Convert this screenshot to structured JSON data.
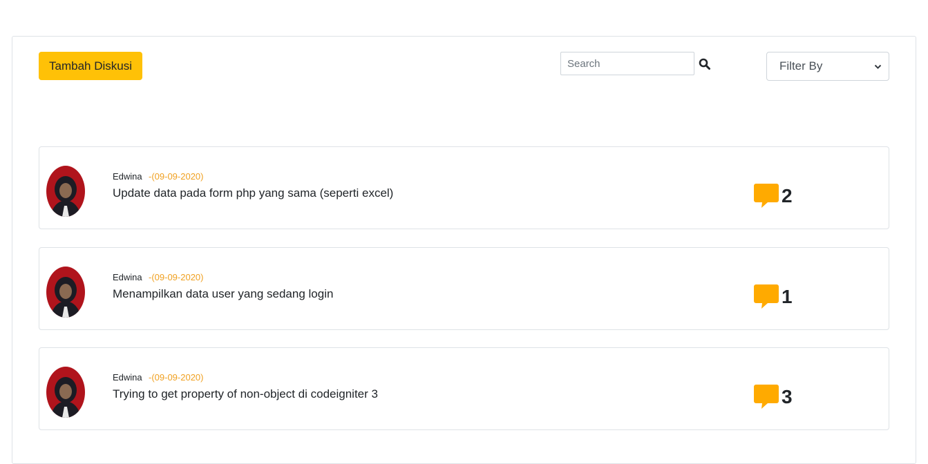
{
  "toolbar": {
    "add_button_label": "Tambah Diskusi",
    "search_placeholder": "Search",
    "filter_label": "Filter By"
  },
  "colors": {
    "accent": "#ffc107",
    "comment_icon": "#ffaa00",
    "date_text": "#f0a020",
    "avatar_background": "#b0141c"
  },
  "discussions": [
    {
      "author": "Edwina",
      "date": "-(09-09-2020)",
      "title": "Update data pada form php yang sama (seperti excel)",
      "comment_count": "2",
      "icon": "speech-bubble-icon"
    },
    {
      "author": "Edwina",
      "date": "-(09-09-2020)",
      "title": "Menampilkan data user yang sedang login",
      "comment_count": "1",
      "icon": "speech-bubble-icon"
    },
    {
      "author": "Edwina",
      "date": "-(09-09-2020)",
      "title": "Trying to get property of non-object di codeigniter 3",
      "comment_count": "3",
      "icon": "speech-bubble-icon"
    }
  ]
}
